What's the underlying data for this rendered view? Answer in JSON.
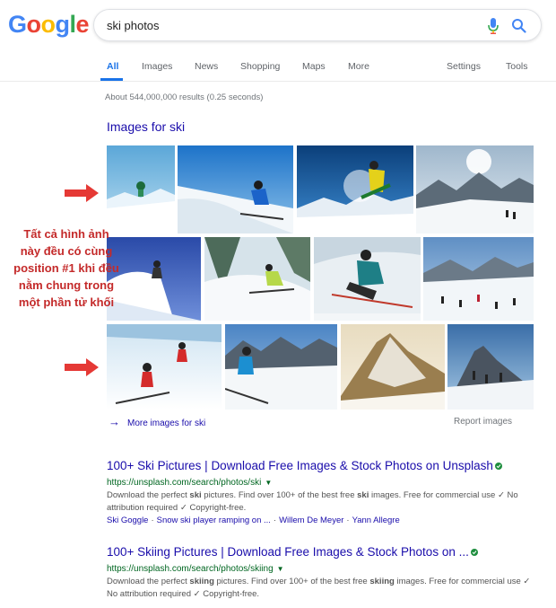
{
  "search": {
    "query": "ski photos"
  },
  "logo": {
    "letters": [
      "G",
      "o",
      "o",
      "g",
      "l",
      "e"
    ],
    "colors": [
      "#4285F4",
      "#EA4335",
      "#FBBC05",
      "#4285F4",
      "#34A853",
      "#EA4335"
    ]
  },
  "tabs": {
    "all": "All",
    "images": "Images",
    "news": "News",
    "shopping": "Shopping",
    "maps": "Maps",
    "more": "More",
    "settings": "Settings",
    "tools": "Tools"
  },
  "stats": "About 544,000,000 results (0.25 seconds)",
  "images_block": {
    "title": "Images for ski",
    "more_link": "More images for ski",
    "report": "Report images"
  },
  "annotation": {
    "text": "Tất cả hình ảnh này đều có cùng position #1 khi đều nằm chung trong một phần tử khối",
    "color": "#c42a2a"
  },
  "results": [
    {
      "title": "100+ Ski Pictures | Download Free Images & Stock Photos on Unsplash",
      "url": "https://unsplash.com/search/photos/ski",
      "snippet_parts": [
        "Download the perfect ",
        "ski",
        " pictures. Find over 100+ of the best free ",
        "ski",
        " images. Free for commercial use ✓ No attribution required ✓ Copyright-free."
      ],
      "sitelinks": [
        "Ski Goggle",
        "Snow ski player ramping on ...",
        "Willem De Meyer",
        "Yann Allegre"
      ]
    },
    {
      "title": "100+ Skiing Pictures | Download Free Images & Stock Photos on ...",
      "url": "https://unsplash.com/search/photos/skiing",
      "snippet_parts": [
        "Download the perfect ",
        "skiing",
        " pictures. Find over 100+ of the best free ",
        "skiing",
        " images. Free for commercial use ✓ No attribution required ✓ Copyright-free."
      ]
    }
  ],
  "colors": {
    "link": "#1a0dab",
    "url": "#006621",
    "accent": "#1a73e8",
    "arrow": "#e53935"
  }
}
